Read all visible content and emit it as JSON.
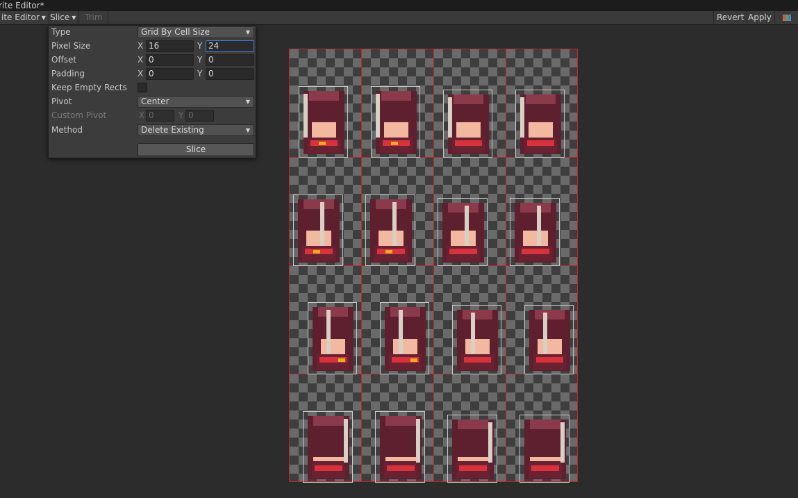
{
  "window": {
    "title": "rite Editor*"
  },
  "toolbar": {
    "mode": "ite Editor",
    "slice": "Slice",
    "trim": "Trim",
    "revert": "Revert",
    "apply": "Apply",
    "color_icon": "color-channels-icon"
  },
  "slice_panel": {
    "type_label": "Type",
    "type_value": "Grid By Cell Size",
    "pixel_size_label": "Pixel Size",
    "pixel_size_x": "16",
    "pixel_size_y": "24",
    "offset_label": "Offset",
    "offset_x": "0",
    "offset_y": "0",
    "padding_label": "Padding",
    "padding_x": "0",
    "padding_y": "0",
    "keep_empty_label": "Keep Empty Rects",
    "keep_empty_checked": false,
    "pivot_label": "Pivot",
    "pivot_value": "Center",
    "custom_pivot_label": "Custom Pivot",
    "custom_pivot_x": "0",
    "custom_pivot_y": "0",
    "method_label": "Method",
    "method_value": "Delete Existing",
    "slice_button": "Slice",
    "axis_x": "X",
    "axis_y": "Y"
  },
  "sprite_sheet": {
    "rows": 4,
    "columns": 4,
    "grid_color": "#c0262c",
    "sprite_colors": {
      "hair": "#5e1f2e",
      "skin": "#f2b8a0",
      "accent": "#d8323c",
      "gold": "#e8b020"
    }
  }
}
